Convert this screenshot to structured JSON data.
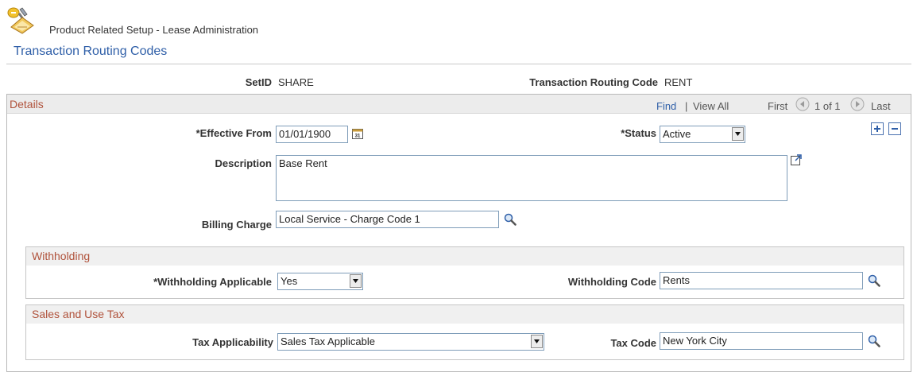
{
  "header": {
    "breadcrumb": "Product Related Setup - Lease Administration",
    "page_title": "Transaction Routing Codes"
  },
  "key_fields": {
    "setid_label": "SetID",
    "setid_value": "SHARE",
    "trc_label": "Transaction Routing Code",
    "trc_value": "RENT"
  },
  "details": {
    "header": "Details",
    "find_link": "Find",
    "separator": "|",
    "view_all_link": "View All",
    "first_label": "First",
    "range_text": "1 of 1",
    "last_label": "Last",
    "effective_from_label": "*Effective From",
    "effective_from_value": "01/01/1900",
    "status_label": "*Status",
    "status_value": "Active",
    "description_label": "Description",
    "description_value": "Base Rent",
    "billing_charge_label": "Billing Charge",
    "billing_charge_value": "Local Service - Charge Code 1"
  },
  "withholding": {
    "header": "Withholding",
    "applicable_label": "*Withholding Applicable",
    "applicable_value": "Yes",
    "code_label": "Withholding Code",
    "code_value": "Rents"
  },
  "sales_tax": {
    "header": "Sales and Use Tax",
    "applicability_label": "Tax Applicability",
    "applicability_value": "Sales Tax Applicable",
    "tax_code_label": "Tax Code",
    "tax_code_value": "New York City"
  },
  "icons": {
    "page_icon": "setup-tools-icon",
    "calendar": "calendar-icon",
    "lookup": "magnifier-icon",
    "expand": "expand-textarea-icon",
    "prev": "previous-arrow-icon",
    "next": "next-arrow-icon",
    "add": "add-row-icon",
    "delete": "delete-row-icon"
  },
  "colors": {
    "section_header_text": "#b0523b",
    "link": "#2f5fa8",
    "title": "#2f5fa8"
  }
}
